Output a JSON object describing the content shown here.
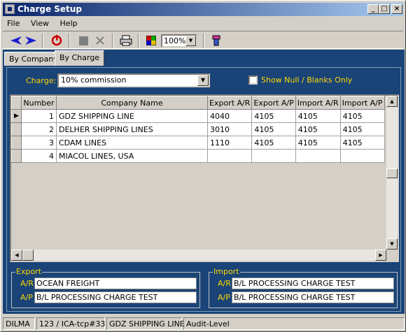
{
  "window": {
    "title": "Charge Setup",
    "buttons": {
      "minimize": "_",
      "maximize": "□",
      "close": "×"
    }
  },
  "menu": {
    "file": "File",
    "view": "View",
    "help": "Help"
  },
  "toolbar": {
    "zoom_value": "100%",
    "icons": [
      "back-arrow-icon",
      "forward-arrow-icon",
      "refresh-icon",
      "stop-icon",
      "cancel-icon",
      "print-icon",
      "color-grid-icon",
      "zoom-select",
      "tools-icon"
    ],
    "accent_colors": {
      "arrows": "#1c1cd0",
      "refresh": "#cc0000",
      "window_title": "#0a246a",
      "panel_bg": "#1a4478",
      "label_yellow": "#ffd700"
    }
  },
  "tabs": [
    {
      "label": "By Company",
      "active": false
    },
    {
      "label": "By Charge",
      "active": true
    }
  ],
  "filter": {
    "charge_label": "Charge:",
    "charge_value": "10% commission",
    "show_null_label": "Show Null / Blanks Only",
    "show_null_checked": false
  },
  "grid": {
    "columns": [
      "Number",
      "Company Name",
      "Export A/R",
      "Export A/P",
      "Import A/R",
      "Import A/P"
    ],
    "rows": [
      {
        "indicator": "▶",
        "number": "1",
        "company": "GDZ SHIPPING LINE",
        "export_ar": "4040",
        "export_ap": "4105",
        "import_ar": "4105",
        "import_ap": "4105"
      },
      {
        "indicator": "",
        "number": "2",
        "company": "DELHER SHIPPING LINES",
        "export_ar": "3010",
        "export_ap": "4105",
        "import_ar": "4105",
        "import_ap": "4105"
      },
      {
        "indicator": "",
        "number": "3",
        "company": "CDAM LINES",
        "export_ar": "1110",
        "export_ap": "4105",
        "import_ar": "4105",
        "import_ap": "4105"
      },
      {
        "indicator": "",
        "number": "4",
        "company": "MIACOL LINES, USA",
        "export_ar": "",
        "export_ap": "",
        "import_ar": "",
        "import_ap": ""
      }
    ]
  },
  "export_group": {
    "title": "Export",
    "ar_label": "A/R",
    "ar_value": "OCEAN FREIGHT",
    "ap_label": "A/P",
    "ap_value": "B/L PROCESSING CHARGE TEST"
  },
  "import_group": {
    "title": "Import",
    "ar_label": "A/R",
    "ar_value": "B/L PROCESSING CHARGE TEST",
    "ap_label": "A/P",
    "ap_value": "B/L PROCESSING CHARGE TEST"
  },
  "status": {
    "company": "DILMA",
    "session": "123 / ICA-tcp#33",
    "record": "GDZ SHIPPING LINE",
    "level": "Audit-Level"
  }
}
